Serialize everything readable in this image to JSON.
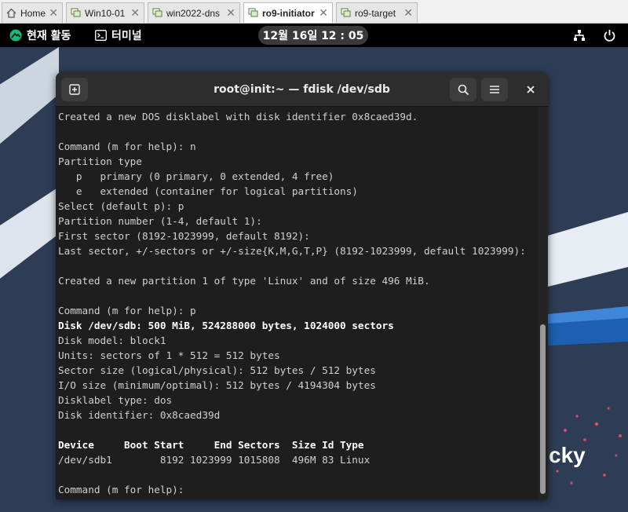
{
  "vm_tabs": [
    {
      "label": "Home",
      "icon": "home-icon",
      "active": false
    },
    {
      "label": "Win10-01",
      "icon": "vm-icon",
      "active": false
    },
    {
      "label": "win2022-dns",
      "icon": "vm-icon",
      "active": false
    },
    {
      "label": "ro9-initiator",
      "icon": "vm-icon",
      "active": true
    },
    {
      "label": "ro9-target",
      "icon": "vm-icon",
      "active": false
    }
  ],
  "topbar": {
    "activities_label": "현재 활동",
    "app_label": "터미널",
    "clock": "12월 16일  12 : 05"
  },
  "terminal": {
    "title": "root@init:~ — fdisk /dev/sdb",
    "lines": [
      "Created a new DOS disklabel with disk identifier 0x8caed39d.",
      "",
      "Command (m for help): n",
      "Partition type",
      "   p   primary (0 primary, 0 extended, 4 free)",
      "   e   extended (container for logical partitions)",
      "Select (default p): p",
      "Partition number (1-4, default 1):",
      "First sector (8192-1023999, default 8192):",
      "Last sector, +/-sectors or +/-size{K,M,G,T,P} (8192-1023999, default 1023999):",
      "",
      "Created a new partition 1 of type 'Linux' and of size 496 MiB.",
      "",
      "Command (m for help): p",
      "Disk /dev/sdb: 500 MiB, 524288000 bytes, 1024000 sectors",
      "Disk model: block1",
      "Units: sectors of 1 * 512 = 512 bytes",
      "Sector size (logical/physical): 512 bytes / 512 bytes",
      "I/O size (minimum/optimal): 512 bytes / 4194304 bytes",
      "Disklabel type: dos",
      "Disk identifier: 0x8caed39d",
      "",
      "Device     Boot Start     End Sectors  Size Id Type",
      "/dev/sdb1        8192 1023999 1015808  496M 83 Linux",
      "",
      "Command (m for help): "
    ],
    "bold_lines": [
      14,
      22
    ]
  },
  "wallpaper_text": "cky"
}
